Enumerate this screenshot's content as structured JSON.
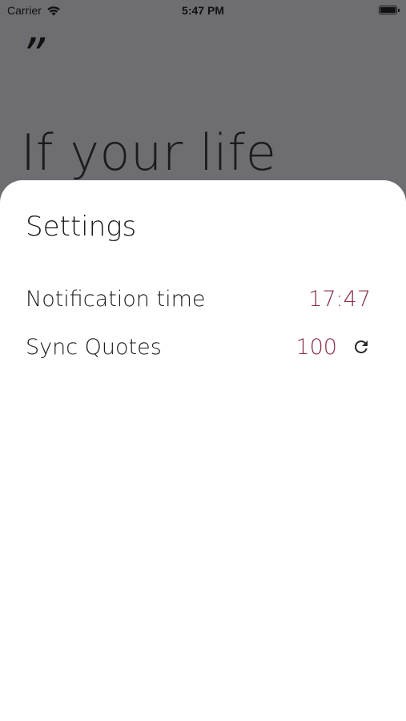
{
  "status_bar": {
    "carrier": "Carrier",
    "time": "5:47 PM",
    "icons": [
      "wifi-icon",
      "battery-icon"
    ]
  },
  "background": {
    "quote_mark": "”",
    "quote_text": "If your life"
  },
  "settings": {
    "title": "Settings",
    "notification_time_label": "Notification time",
    "notification_time_value": "17:47",
    "sync_quotes_label": "Sync Quotes",
    "sync_quotes_count": "100",
    "sync_icon": "refresh-icon"
  },
  "colors": {
    "accent": "#8b3049",
    "overlay": "#6e6d71",
    "sheet": "#ffffff"
  }
}
